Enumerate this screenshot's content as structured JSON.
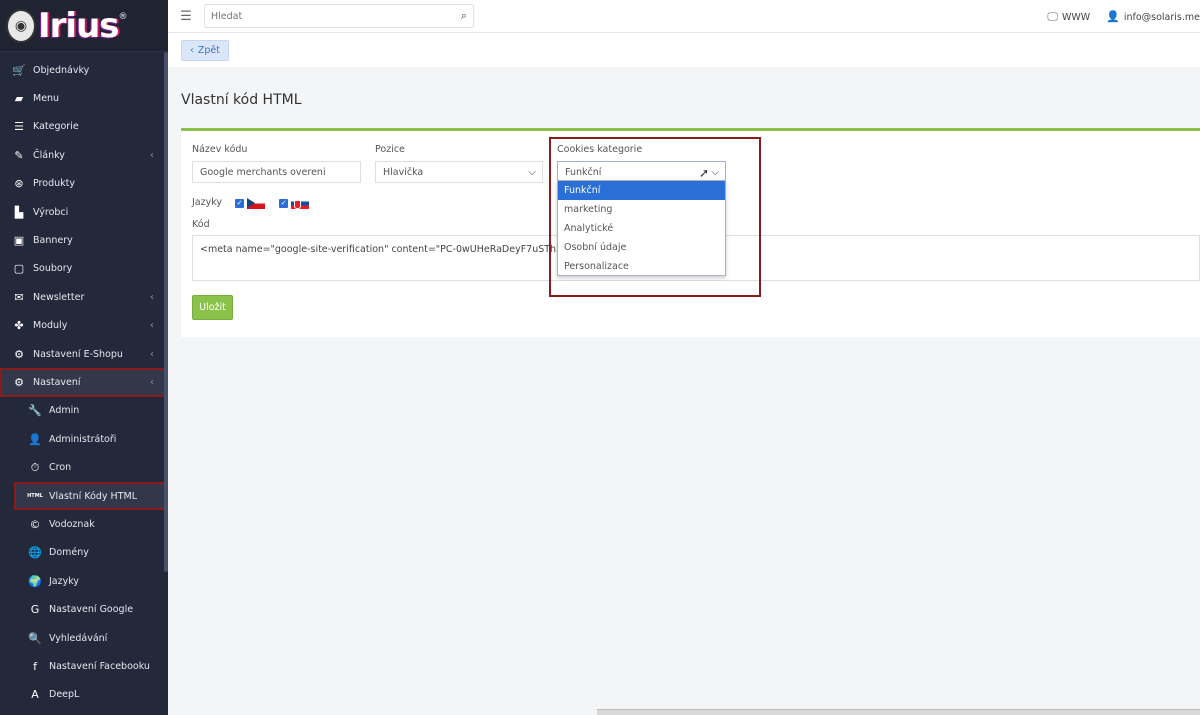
{
  "brand": {
    "logo_text": "Irius",
    "logo_reg": "®"
  },
  "sidebar": {
    "items": [
      {
        "label": "Objednávky",
        "icon": "cart-icon",
        "glyph": "🛒"
      },
      {
        "label": "Menu",
        "icon": "folder-icon",
        "glyph": "▰"
      },
      {
        "label": "Kategorie",
        "icon": "list-icon",
        "glyph": "☰"
      },
      {
        "label": "Články",
        "icon": "pencil-icon",
        "glyph": "✎",
        "has_sub": true
      },
      {
        "label": "Produkty",
        "icon": "dribbble-icon",
        "glyph": "⊛"
      },
      {
        "label": "Výrobci",
        "icon": "building-icon",
        "glyph": "▙"
      },
      {
        "label": "Bannery",
        "icon": "image-icon",
        "glyph": "▣"
      },
      {
        "label": "Soubory",
        "icon": "file-icon",
        "glyph": "▢"
      },
      {
        "label": "Newsletter",
        "icon": "envelope-icon",
        "glyph": "✉",
        "has_sub": true
      },
      {
        "label": "Moduly",
        "icon": "puzzle-icon",
        "glyph": "✤",
        "has_sub": true
      },
      {
        "label": "Nastavení E-Shopu",
        "icon": "cogs-icon",
        "glyph": "⚙",
        "has_sub": true
      },
      {
        "label": "Nastavení",
        "icon": "cogs-icon",
        "glyph": "⚙",
        "has_sub": true
      }
    ],
    "subitems": [
      {
        "label": "Admin",
        "icon": "wrench-icon",
        "glyph": "🔧"
      },
      {
        "label": "Administrátoři",
        "icon": "user-icon",
        "glyph": "👤"
      },
      {
        "label": "Cron",
        "icon": "stopwatch-icon",
        "glyph": "⏱"
      },
      {
        "label": "Vlastní Kódy HTML",
        "icon": "html-icon",
        "glyph": "HTML"
      },
      {
        "label": "Vodoznak",
        "icon": "copyright-icon",
        "glyph": "©"
      },
      {
        "label": "Domény",
        "icon": "globe-icon",
        "glyph": "🌐"
      },
      {
        "label": "Jazyky",
        "icon": "globe-icon",
        "glyph": "🌍"
      },
      {
        "label": "Nastavení Google",
        "icon": "google-icon",
        "glyph": "G"
      },
      {
        "label": "Vyhledávání",
        "icon": "search-icon",
        "glyph": "🔍"
      },
      {
        "label": "Nastavení Facebooku",
        "icon": "facebook-icon",
        "glyph": "f"
      },
      {
        "label": "DeepL",
        "icon": "translate-icon",
        "glyph": "A"
      }
    ],
    "sub_chevron": "‹"
  },
  "topbar": {
    "search_placeholder": "Hledat",
    "www_label": "WWW",
    "user_email": "info@solaris.me"
  },
  "back_label": "Zpět",
  "page_title": "Vlastní kód HTML",
  "form": {
    "name_label": "Název kódu",
    "name_value": "Google merchants overeni",
    "position_label": "Pozice",
    "position_value": "Hlavička",
    "cookies_label": "Cookies kategorie",
    "cookies_value": "Funkční",
    "cookies_options": [
      "Funkční",
      "marketing",
      "Analytické",
      "Osobní údaje",
      "Personalizace"
    ],
    "languages_label": "Jazyky",
    "code_label": "Kód",
    "code_value": "<meta name=\"google-site-verification\" content=\"PC-0wUHeRaDeyF7uSThXzLpod",
    "save_label": "Uložit"
  }
}
